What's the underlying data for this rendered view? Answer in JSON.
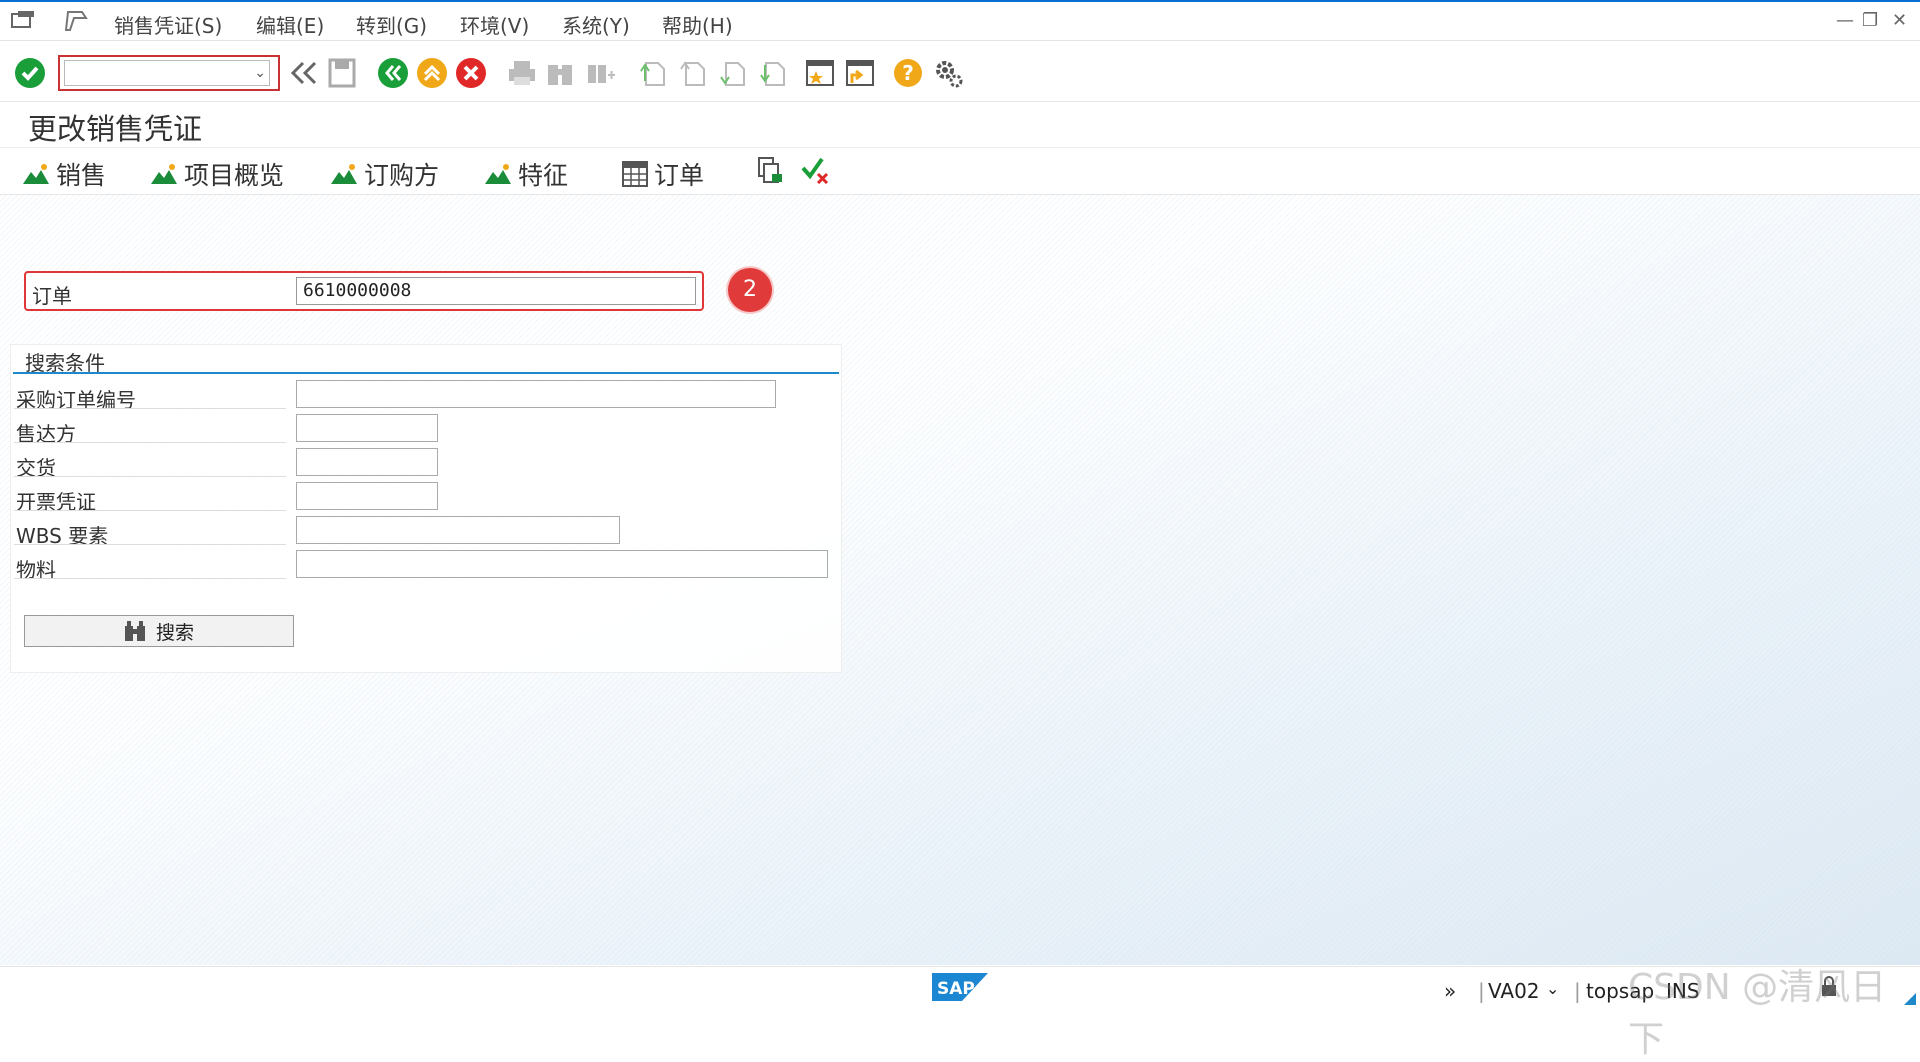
{
  "menubar": {
    "items": [
      "销售凭证(S)",
      "编辑(E)",
      "转到(G)",
      "环境(V)",
      "系统(Y)",
      "帮助(H)"
    ]
  },
  "toolbar": {
    "command_field_value": ""
  },
  "page_title": "更改销售凭证",
  "app_toolbar": {
    "items": [
      "销售",
      "项目概览",
      "订购方",
      "特征",
      "订单"
    ]
  },
  "order": {
    "label": "订单",
    "value": "6610000008"
  },
  "step_badge": "2",
  "search": {
    "title": "搜索条件",
    "fields": [
      {
        "label": "采购订单编号",
        "value": ""
      },
      {
        "label": "售达方",
        "value": ""
      },
      {
        "label": "交货",
        "value": ""
      },
      {
        "label": "开票凭证",
        "value": ""
      },
      {
        "label": "WBS 要素",
        "value": ""
      },
      {
        "label": "物料",
        "value": ""
      }
    ],
    "button_label": "搜索"
  },
  "statusbar": {
    "logo": "SAP",
    "transaction": "VA02",
    "server": "topsap",
    "mode": "INS"
  },
  "watermark": "CSDN @清风日下",
  "colors": {
    "accent": "#0a6ed1",
    "highlight_border": "#e03636",
    "badge": "#e03a3a",
    "enter_green": "#1a9e3a",
    "back_green": "#1a9e3a",
    "exit_orange": "#f0a818",
    "cancel_red": "#e02828"
  }
}
